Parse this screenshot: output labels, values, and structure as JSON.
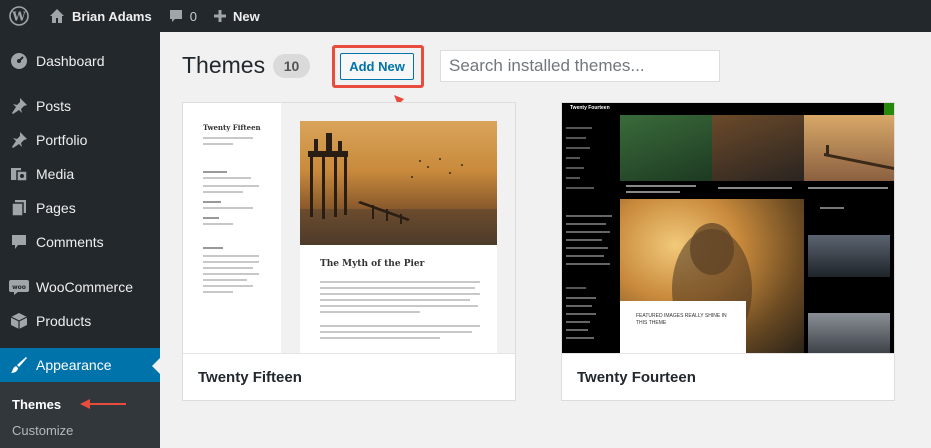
{
  "admin_bar": {
    "site_name": "Brian Adams",
    "comments_count": "0",
    "new_label": "New"
  },
  "sidebar": {
    "items": [
      {
        "label": "Dashboard",
        "icon": "dashboard-icon"
      },
      {
        "label": "Posts",
        "icon": "pin-icon"
      },
      {
        "label": "Portfolio",
        "icon": "pin-icon"
      },
      {
        "label": "Media",
        "icon": "media-icon"
      },
      {
        "label": "Pages",
        "icon": "pages-icon"
      },
      {
        "label": "Comments",
        "icon": "comment-icon"
      },
      {
        "label": "WooCommerce",
        "icon": "woocommerce-icon"
      },
      {
        "label": "Products",
        "icon": "box-icon"
      },
      {
        "label": "Appearance",
        "icon": "brush-icon",
        "current": true
      }
    ],
    "submenu": [
      {
        "label": "Themes",
        "current": true
      },
      {
        "label": "Customize"
      }
    ]
  },
  "header": {
    "title": "Themes",
    "count": "10",
    "add_new_label": "Add New",
    "search_placeholder": "Search installed themes..."
  },
  "themes": [
    {
      "name": "Twenty Fifteen",
      "preview": {
        "site_title": "Twenty Fifteen",
        "post_title": "The Myth of the Pier"
      }
    },
    {
      "name": "Twenty Fourteen",
      "preview": {
        "site_title": "Twenty Fourteen",
        "hero_caption": "FEATURED IMAGES REALLY SHINE IN THIS THEME"
      }
    }
  ],
  "colors": {
    "admin_bg": "#23282d",
    "accent": "#0073aa",
    "annotation": "#e74c3c",
    "page_bg": "#f1f1f1"
  }
}
